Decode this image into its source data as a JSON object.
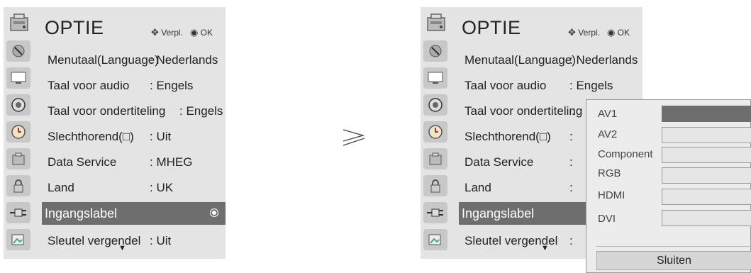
{
  "menu": {
    "title": "OPTIE",
    "hint_move": "Verpl.",
    "hint_ok": "OK",
    "items": [
      {
        "label": "Menutaal(Language)",
        "value": ": Nederlands"
      },
      {
        "label": "Taal voor audio",
        "value": ": Engels"
      },
      {
        "label": "Taal voor ondertiteling",
        "value": ": Engels"
      },
      {
        "label": "Slechthorend(□)",
        "value": ": Uit"
      },
      {
        "label": "Data Service",
        "value": ": MHEG"
      },
      {
        "label": "Land",
        "value": ": UK"
      },
      {
        "label": "Ingangslabel",
        "value": ""
      },
      {
        "label": "Sleutel vergendel",
        "value": ": Uit"
      }
    ],
    "selected_index": 6,
    "sidebar_icons": [
      "satellite-icon",
      "monitor-icon",
      "speaker-icon",
      "clock-icon",
      "option-icon",
      "lock-icon",
      "plug-icon",
      "picture-icon"
    ]
  },
  "right_menu_values": [
    ": Nederlands",
    ": Engels",
    ":",
    ":",
    ":",
    ":",
    "",
    ":"
  ],
  "arrow": "⩾",
  "popup": {
    "items": [
      "AV1",
      "AV2",
      "Component",
      "RGB",
      "HDMI",
      "DVI"
    ],
    "active_index": 0,
    "close_label": "Sluiten"
  },
  "colors": {
    "panel": "#e4e4e4",
    "selected": "#6e6e6e"
  }
}
